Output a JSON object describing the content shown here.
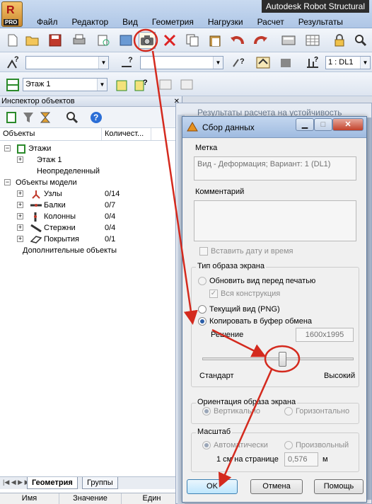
{
  "app": {
    "title": "Autodesk Robot Structural",
    "pro_badge": "PRO",
    "menu": [
      "Файл",
      "Редактор",
      "Вид",
      "Геометрия",
      "Нагрузки",
      "Расчет",
      "Результаты"
    ]
  },
  "toolbar2": {
    "load_case_value": "1 : DL1"
  },
  "toolbar3": {
    "storey_value": "Этаж 1"
  },
  "inspector": {
    "title": "Инспектор объектов",
    "col_objects": "Объекты",
    "col_count": "Количест...",
    "tree": [
      {
        "label": "Этажи",
        "count": ""
      },
      {
        "label": "Этаж 1",
        "count": ""
      },
      {
        "label": "Неопределенный",
        "count": ""
      },
      {
        "label": "Объекты модели",
        "count": ""
      },
      {
        "label": "Узлы",
        "count": "0/14"
      },
      {
        "label": "Балки",
        "count": "0/7"
      },
      {
        "label": "Колонны",
        "count": "0/4"
      },
      {
        "label": "Стержни",
        "count": "0/4"
      },
      {
        "label": "Покрытия",
        "count": "0/1"
      },
      {
        "label": "Дополнительные объекты",
        "count": ""
      }
    ],
    "tabs": [
      "Геометрия",
      "Группы"
    ],
    "footer": [
      "Имя",
      "Значение",
      "Един"
    ]
  },
  "background_window": {
    "title": "Результаты расчета на устойчивость"
  },
  "dialog": {
    "title": "Сбор данных",
    "label_caption": "Метка",
    "label_value": "Вид - Деформация; Вариант: 1 (DL1)",
    "comment_caption": "Комментарий",
    "insert_datetime": "Вставить дату и время",
    "screen_type_group": "Тип образа экрана",
    "opt_refresh": "Обновить вид перед печатью",
    "opt_whole": "Вся конструкция",
    "opt_current": "Текущий вид (PNG)",
    "opt_clipboard": "Копировать в буфер обмена",
    "resolution_label": "Решение",
    "resolution_value": "1600x1995",
    "slider_min": "Стандарт",
    "slider_max": "Высокий",
    "orientation_group": "Ориентация образа экрана",
    "opt_vertical": "Вертикально",
    "opt_horizontal": "Горизонтально",
    "scale_group": "Масштаб",
    "opt_auto": "Автоматически",
    "opt_custom": "Произвольный",
    "cm_per_page": "1 см на странице",
    "scale_value": "0,576",
    "scale_unit": "м",
    "ok": "OK",
    "cancel": "Отмена",
    "help": "Помощь"
  },
  "colors": {
    "annotation_red": "#d42a1e"
  }
}
